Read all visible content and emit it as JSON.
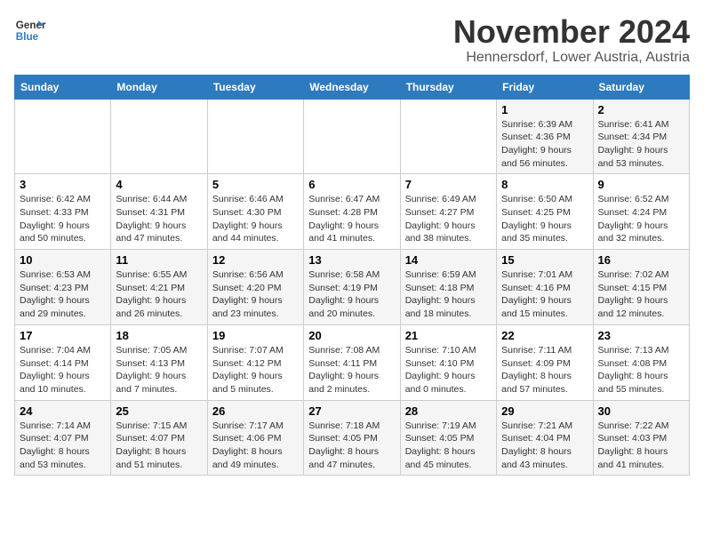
{
  "header": {
    "logo_line1": "General",
    "logo_line2": "Blue",
    "month": "November 2024",
    "location": "Hennersdorf, Lower Austria, Austria"
  },
  "weekdays": [
    "Sunday",
    "Monday",
    "Tuesday",
    "Wednesday",
    "Thursday",
    "Friday",
    "Saturday"
  ],
  "weeks": [
    [
      {
        "day": "",
        "info": ""
      },
      {
        "day": "",
        "info": ""
      },
      {
        "day": "",
        "info": ""
      },
      {
        "day": "",
        "info": ""
      },
      {
        "day": "",
        "info": ""
      },
      {
        "day": "1",
        "info": "Sunrise: 6:39 AM\nSunset: 4:36 PM\nDaylight: 9 hours\nand 56 minutes."
      },
      {
        "day": "2",
        "info": "Sunrise: 6:41 AM\nSunset: 4:34 PM\nDaylight: 9 hours\nand 53 minutes."
      }
    ],
    [
      {
        "day": "3",
        "info": "Sunrise: 6:42 AM\nSunset: 4:33 PM\nDaylight: 9 hours\nand 50 minutes."
      },
      {
        "day": "4",
        "info": "Sunrise: 6:44 AM\nSunset: 4:31 PM\nDaylight: 9 hours\nand 47 minutes."
      },
      {
        "day": "5",
        "info": "Sunrise: 6:46 AM\nSunset: 4:30 PM\nDaylight: 9 hours\nand 44 minutes."
      },
      {
        "day": "6",
        "info": "Sunrise: 6:47 AM\nSunset: 4:28 PM\nDaylight: 9 hours\nand 41 minutes."
      },
      {
        "day": "7",
        "info": "Sunrise: 6:49 AM\nSunset: 4:27 PM\nDaylight: 9 hours\nand 38 minutes."
      },
      {
        "day": "8",
        "info": "Sunrise: 6:50 AM\nSunset: 4:25 PM\nDaylight: 9 hours\nand 35 minutes."
      },
      {
        "day": "9",
        "info": "Sunrise: 6:52 AM\nSunset: 4:24 PM\nDaylight: 9 hours\nand 32 minutes."
      }
    ],
    [
      {
        "day": "10",
        "info": "Sunrise: 6:53 AM\nSunset: 4:23 PM\nDaylight: 9 hours\nand 29 minutes."
      },
      {
        "day": "11",
        "info": "Sunrise: 6:55 AM\nSunset: 4:21 PM\nDaylight: 9 hours\nand 26 minutes."
      },
      {
        "day": "12",
        "info": "Sunrise: 6:56 AM\nSunset: 4:20 PM\nDaylight: 9 hours\nand 23 minutes."
      },
      {
        "day": "13",
        "info": "Sunrise: 6:58 AM\nSunset: 4:19 PM\nDaylight: 9 hours\nand 20 minutes."
      },
      {
        "day": "14",
        "info": "Sunrise: 6:59 AM\nSunset: 4:18 PM\nDaylight: 9 hours\nand 18 minutes."
      },
      {
        "day": "15",
        "info": "Sunrise: 7:01 AM\nSunset: 4:16 PM\nDaylight: 9 hours\nand 15 minutes."
      },
      {
        "day": "16",
        "info": "Sunrise: 7:02 AM\nSunset: 4:15 PM\nDaylight: 9 hours\nand 12 minutes."
      }
    ],
    [
      {
        "day": "17",
        "info": "Sunrise: 7:04 AM\nSunset: 4:14 PM\nDaylight: 9 hours\nand 10 minutes."
      },
      {
        "day": "18",
        "info": "Sunrise: 7:05 AM\nSunset: 4:13 PM\nDaylight: 9 hours\nand 7 minutes."
      },
      {
        "day": "19",
        "info": "Sunrise: 7:07 AM\nSunset: 4:12 PM\nDaylight: 9 hours\nand 5 minutes."
      },
      {
        "day": "20",
        "info": "Sunrise: 7:08 AM\nSunset: 4:11 PM\nDaylight: 9 hours\nand 2 minutes."
      },
      {
        "day": "21",
        "info": "Sunrise: 7:10 AM\nSunset: 4:10 PM\nDaylight: 9 hours\nand 0 minutes."
      },
      {
        "day": "22",
        "info": "Sunrise: 7:11 AM\nSunset: 4:09 PM\nDaylight: 8 hours\nand 57 minutes."
      },
      {
        "day": "23",
        "info": "Sunrise: 7:13 AM\nSunset: 4:08 PM\nDaylight: 8 hours\nand 55 minutes."
      }
    ],
    [
      {
        "day": "24",
        "info": "Sunrise: 7:14 AM\nSunset: 4:07 PM\nDaylight: 8 hours\nand 53 minutes."
      },
      {
        "day": "25",
        "info": "Sunrise: 7:15 AM\nSunset: 4:07 PM\nDaylight: 8 hours\nand 51 minutes."
      },
      {
        "day": "26",
        "info": "Sunrise: 7:17 AM\nSunset: 4:06 PM\nDaylight: 8 hours\nand 49 minutes."
      },
      {
        "day": "27",
        "info": "Sunrise: 7:18 AM\nSunset: 4:05 PM\nDaylight: 8 hours\nand 47 minutes."
      },
      {
        "day": "28",
        "info": "Sunrise: 7:19 AM\nSunset: 4:05 PM\nDaylight: 8 hours\nand 45 minutes."
      },
      {
        "day": "29",
        "info": "Sunrise: 7:21 AM\nSunset: 4:04 PM\nDaylight: 8 hours\nand 43 minutes."
      },
      {
        "day": "30",
        "info": "Sunrise: 7:22 AM\nSunset: 4:03 PM\nDaylight: 8 hours\nand 41 minutes."
      }
    ]
  ]
}
